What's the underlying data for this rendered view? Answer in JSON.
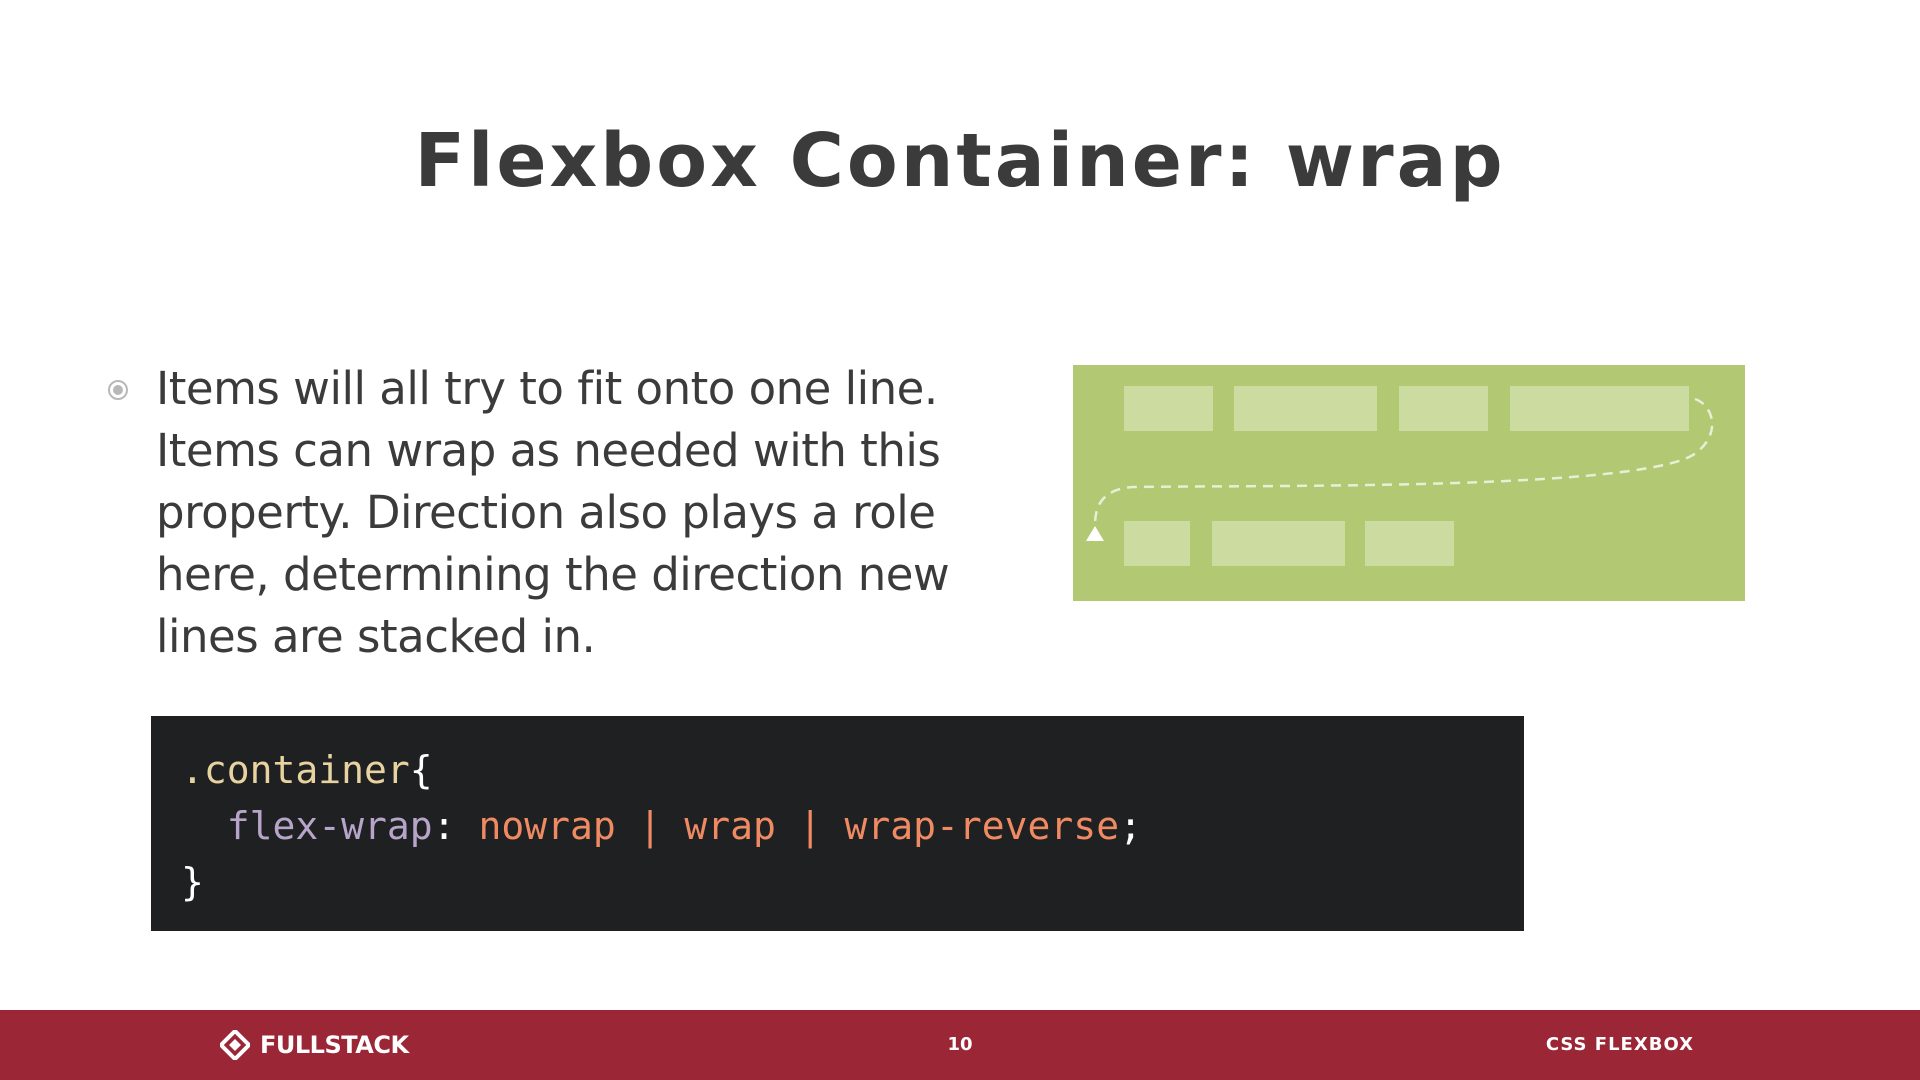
{
  "slide": {
    "title": "Flexbox Container: wrap",
    "bullet_text": "Items will all try to fit onto one line. Items can wrap as needed with this property. Direction also plays a role here, determining the direction new lines are stacked in."
  },
  "diagram": {
    "background_color": "#b2c872",
    "item_color": "#ccdba0",
    "arrow_color": "#ffffff",
    "row1_items": 4,
    "row2_items": 3
  },
  "code": {
    "selector": ".container",
    "open_brace": "{",
    "property": "flex-wrap",
    "colon": ":",
    "value1": "nowrap",
    "sep1": " | ",
    "value2": "wrap",
    "sep2": " | ",
    "value3": "wrap-reverse",
    "semicolon": ";",
    "close_brace": "}"
  },
  "footer": {
    "logo_text": "FULLSTACK",
    "page_number": "10",
    "label": "CSS FLEXBOX",
    "background_color": "#9a2636"
  }
}
